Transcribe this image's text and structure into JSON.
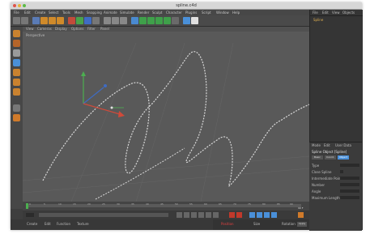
{
  "window": {
    "title": "spline.c4d"
  },
  "menubar": {
    "items": [
      "File",
      "Edit",
      "Create",
      "Select",
      "Tools",
      "Mesh",
      "Snapping",
      "Animate",
      "Simulate",
      "Render",
      "Sculpt",
      "Character",
      "Plugins",
      "Script",
      "Window",
      "Help"
    ]
  },
  "viewport": {
    "menu": [
      "View",
      "Cameras",
      "Display",
      "Options",
      "Filter",
      "Panel"
    ],
    "label": "Perspective"
  },
  "timeline": {
    "ticks": [
      "0",
      "5",
      "10",
      "15",
      "20",
      "25",
      "30",
      "35",
      "40",
      "45",
      "50",
      "55",
      "60",
      "65",
      "70",
      "75",
      "80",
      "85",
      "90"
    ],
    "end": "90 F"
  },
  "bottom": {
    "items": [
      "Create",
      "Edit",
      "Function",
      "Texture"
    ]
  },
  "objects_panel": {
    "tabs": [
      "File",
      "Edit",
      "View",
      "Objects"
    ],
    "object_name": "Spline"
  },
  "attributes_panel": {
    "tabs": [
      "Mode",
      "Edit",
      "User Data"
    ],
    "object_label": "Spline Object [Spline]",
    "buttons": [
      "Basic",
      "Coord.",
      "Object"
    ],
    "fields": [
      "Type",
      "Close Spline",
      "Intermediate Points",
      "Number",
      "Angle",
      "Maximum Length"
    ]
  },
  "coords": {
    "headers": [
      "Position",
      "Size",
      "Rotation"
    ],
    "apply": "Apply"
  },
  "colors": {
    "accent": "#4a90d9",
    "spline": "#d8d8d8"
  }
}
